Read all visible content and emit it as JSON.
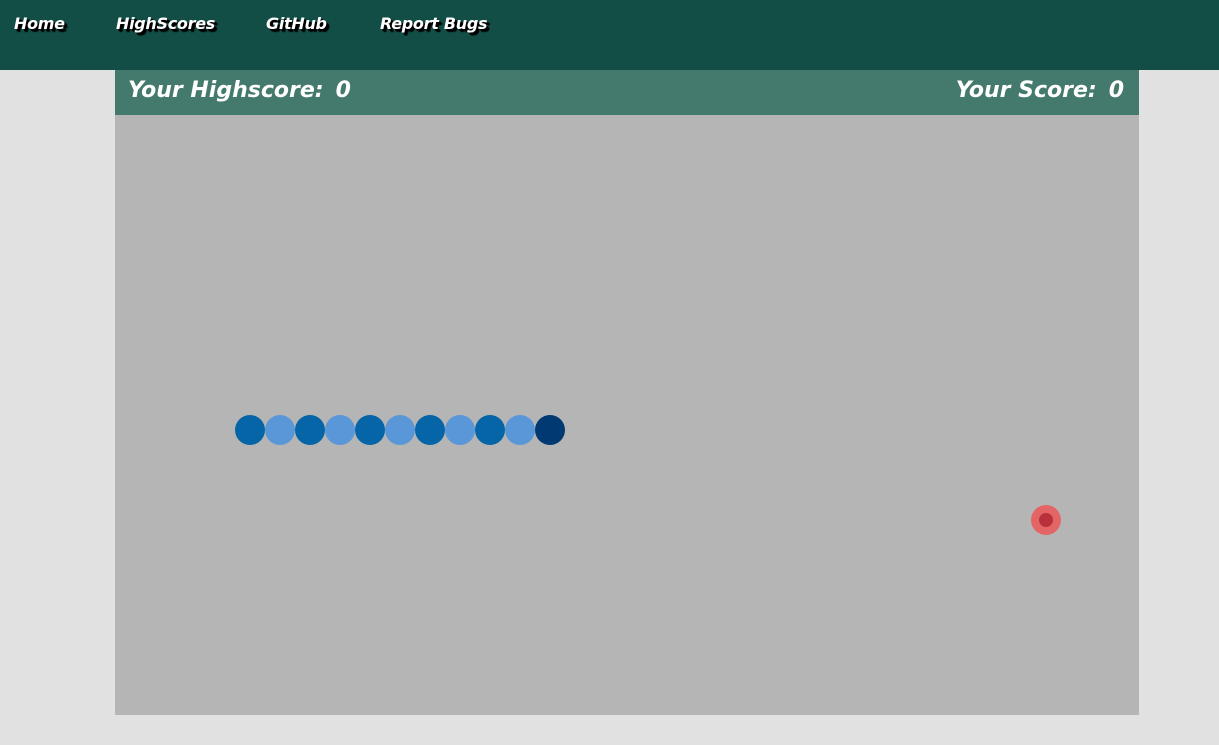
{
  "nav": {
    "items": [
      {
        "label": "Home"
      },
      {
        "label": "HighScores"
      },
      {
        "label": "GitHub"
      },
      {
        "label": "Report Bugs"
      }
    ]
  },
  "scores": {
    "highscore_label": "Your Highscore:",
    "highscore_value": "0",
    "score_label": "Your Score:",
    "score_value": "0"
  },
  "game": {
    "grid_cell_count": {
      "cols": 34,
      "rows": 20
    },
    "snake": {
      "segments": [
        {
          "col": 4,
          "row": 10,
          "color": "#0565a6"
        },
        {
          "col": 5,
          "row": 10,
          "color": "#5a97d8"
        },
        {
          "col": 6,
          "row": 10,
          "color": "#0565a6"
        },
        {
          "col": 7,
          "row": 10,
          "color": "#5a97d8"
        },
        {
          "col": 8,
          "row": 10,
          "color": "#0565a6"
        },
        {
          "col": 9,
          "row": 10,
          "color": "#5a97d8"
        },
        {
          "col": 10,
          "row": 10,
          "color": "#0565a6"
        },
        {
          "col": 11,
          "row": 10,
          "color": "#5a97d8"
        },
        {
          "col": 12,
          "row": 10,
          "color": "#0565a6"
        },
        {
          "col": 13,
          "row": 10,
          "color": "#5a97d8"
        },
        {
          "col": 14,
          "row": 10,
          "color": "#013a72",
          "head": true
        }
      ]
    },
    "food": {
      "col": 31,
      "row": 13
    }
  },
  "colors": {
    "navbar": "#134e46",
    "score_bar": "#447a6d",
    "board": "#b5b5b5",
    "page": "#e1e1e1"
  }
}
